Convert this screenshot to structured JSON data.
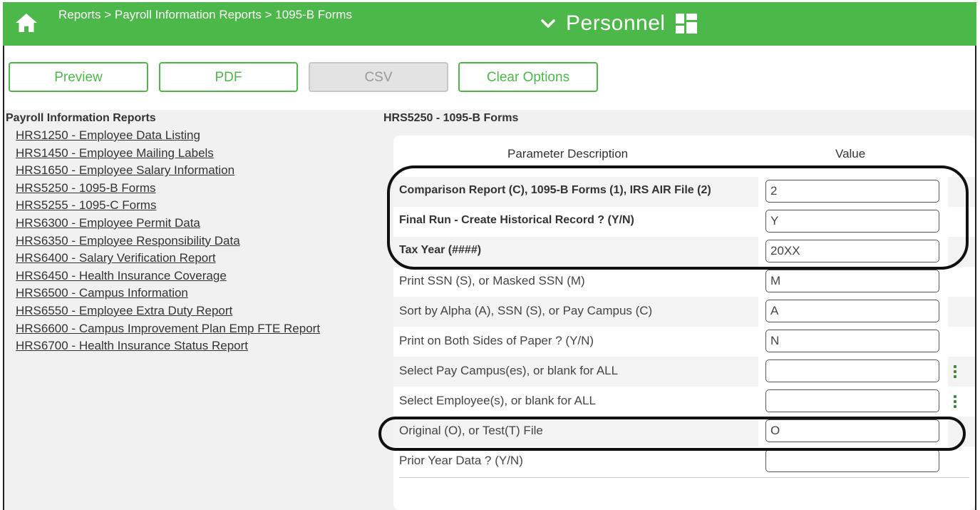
{
  "header": {
    "breadcrumb": "Reports > Payroll Information Reports > 1095-B Forms",
    "module": "Personnel",
    "icons": {
      "home": "home-icon",
      "module_menu": "chevron-down-icon",
      "apps": "grid-icon"
    },
    "accent_color": "#4cb849"
  },
  "toolbar": {
    "preview": "Preview",
    "pdf": "PDF",
    "csv": "CSV",
    "clear": "Clear Options"
  },
  "left_panel": {
    "title": "Payroll Information Reports",
    "reports": [
      "HRS1250 - Employee Data Listing",
      "HRS1450 - Employee Mailing Labels",
      "HRS1650 - Employee Salary Information",
      "HRS5250 - 1095-B Forms",
      "HRS5255 - 1095-C Forms",
      "HRS6300 - Employee Permit Data",
      "HRS6350 - Employee Responsibility Data",
      "HRS6400 - Salary Verification Report",
      "HRS6450 - Health Insurance Coverage",
      "HRS6500 - Campus Information",
      "HRS6550 - Employee Extra Duty Report",
      "HRS6600 - Campus Improvement Plan Emp FTE Report",
      "HRS6700 - Health Insurance Status Report"
    ]
  },
  "right_panel": {
    "title": "HRS5250 - 1095-B Forms",
    "col_param": "Parameter Description",
    "col_value": "Value",
    "params": [
      {
        "label": "Comparison Report (C), 1095-B Forms (1), IRS AIR File (2)",
        "value": "2"
      },
      {
        "label": "Final Run - Create Historical Record ? (Y/N)",
        "value": "Y"
      },
      {
        "label": "Tax Year (####)",
        "value": "20XX"
      },
      {
        "label": "Print SSN (S), or Masked SSN (M)",
        "value": "M"
      },
      {
        "label": "Sort by Alpha (A), SSN (S), or Pay Campus (C)",
        "value": "A"
      },
      {
        "label": "Print on Both Sides of Paper ? (Y/N)",
        "value": "N"
      },
      {
        "label": "Select Pay Campus(es), or blank for ALL",
        "value": ""
      },
      {
        "label": "Select Employee(s), or blank for ALL",
        "value": ""
      },
      {
        "label": "Original (O), or Test(T) File",
        "value": "O"
      },
      {
        "label": "Prior Year Data ? (Y/N)",
        "value": ""
      }
    ]
  }
}
